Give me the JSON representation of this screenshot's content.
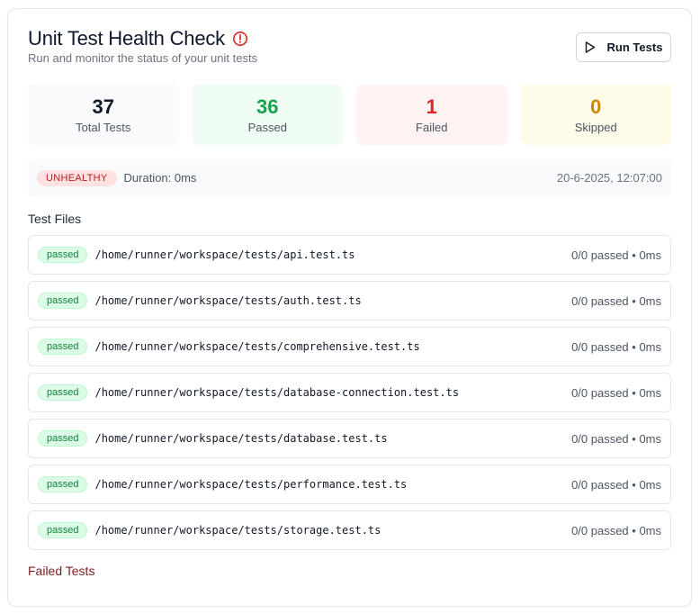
{
  "header": {
    "title": "Unit Test Health Check",
    "subtitle": "Run and monitor the status of your unit tests",
    "run_button": "Run Tests"
  },
  "stats": {
    "total": {
      "value": "37",
      "label": "Total Tests"
    },
    "passed": {
      "value": "36",
      "label": "Passed"
    },
    "failed": {
      "value": "1",
      "label": "Failed"
    },
    "skipped": {
      "value": "0",
      "label": "Skipped"
    }
  },
  "status": {
    "badge": "UNHEALTHY",
    "duration": "Duration: 0ms",
    "timestamp": "20-6-2025, 12:07:00"
  },
  "test_files_title": "Test Files",
  "files": [
    {
      "status": "passed",
      "path": "/home/runner/workspace/tests/api.test.ts",
      "result": "0/0 passed • 0ms"
    },
    {
      "status": "passed",
      "path": "/home/runner/workspace/tests/auth.test.ts",
      "result": "0/0 passed • 0ms"
    },
    {
      "status": "passed",
      "path": "/home/runner/workspace/tests/comprehensive.test.ts",
      "result": "0/0 passed • 0ms"
    },
    {
      "status": "passed",
      "path": "/home/runner/workspace/tests/database-connection.test.ts",
      "result": "0/0 passed • 0ms"
    },
    {
      "status": "passed",
      "path": "/home/runner/workspace/tests/database.test.ts",
      "result": "0/0 passed • 0ms"
    },
    {
      "status": "passed",
      "path": "/home/runner/workspace/tests/performance.test.ts",
      "result": "0/0 passed • 0ms"
    },
    {
      "status": "passed",
      "path": "/home/runner/workspace/tests/storage.test.ts",
      "result": "0/0 passed • 0ms"
    }
  ],
  "failed_tests_title": "Failed Tests",
  "icons": {
    "title_icon": "alert-circle-icon",
    "run_icon": "play-icon"
  },
  "colors": {
    "passed": "#16a34a",
    "failed": "#dc2626",
    "skipped": "#ca8a04",
    "unhealthy": "#b91c1c"
  }
}
